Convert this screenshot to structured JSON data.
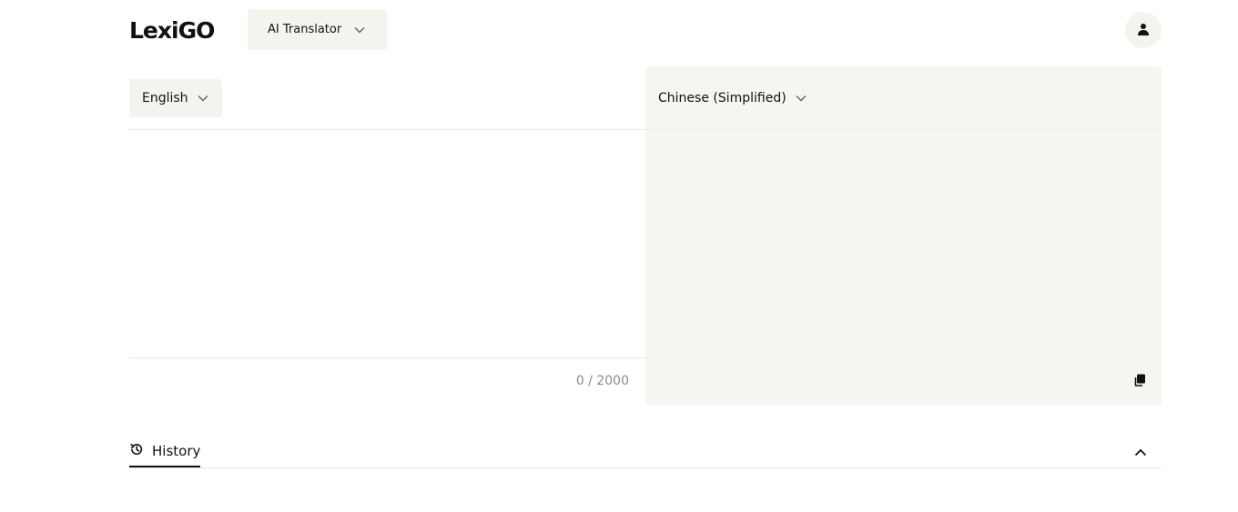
{
  "header": {
    "logo_text": "LexiGO",
    "mode_selector": {
      "label": "AI Translator",
      "icon": "chevron-down-icon"
    },
    "account_icon": "user-icon"
  },
  "source": {
    "language": "English",
    "text": "",
    "char_count": "0 / 2000"
  },
  "target": {
    "language": "Chinese (Simplified)",
    "text": "",
    "copy_icon": "copy-icon"
  },
  "history": {
    "label": "History",
    "icon": "history-icon",
    "toggle_icon": "chevron-up-icon"
  },
  "colors": {
    "panel_background": "#f6f6f1",
    "selector_background": "#f4f4ef",
    "text": "#111111",
    "muted_text": "#8a8a8a"
  }
}
